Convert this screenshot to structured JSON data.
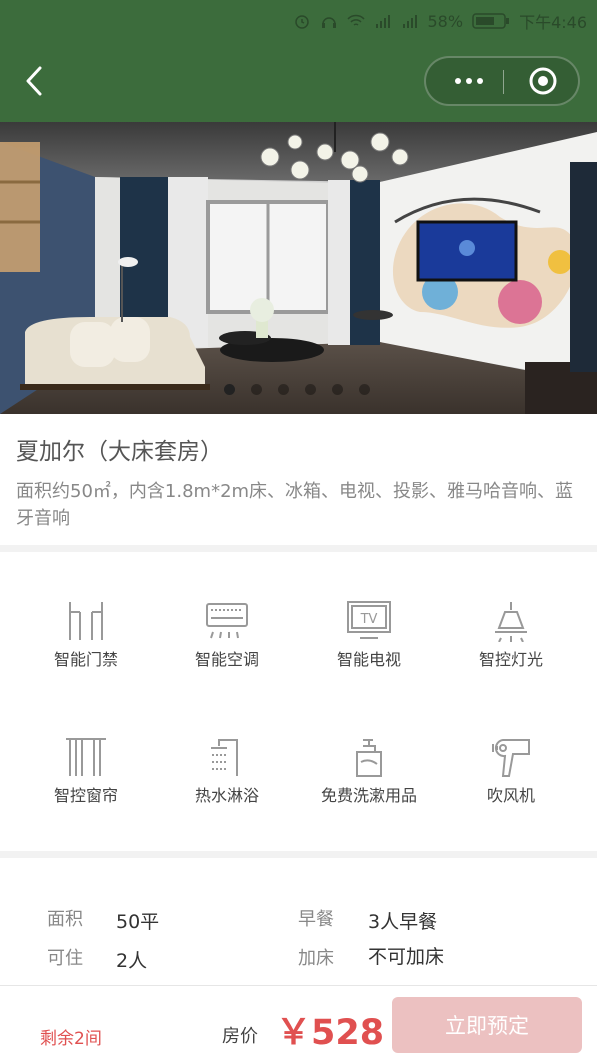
{
  "status_bar": {
    "battery": "58%",
    "time": "下午4:46"
  },
  "room": {
    "name": "夏加尔（大床套房）",
    "description": "面积约50㎡，内含1.8m*2m床、冰箱、电视、投影、雅马哈音响、蓝牙音响"
  },
  "carousel": {
    "count": 6,
    "active": 0
  },
  "amenities": [
    {
      "label": "智能门禁",
      "icon": "door-access-icon"
    },
    {
      "label": "智能空调",
      "icon": "air-conditioner-icon"
    },
    {
      "label": "智能电视",
      "icon": "tv-icon"
    },
    {
      "label": "智控灯光",
      "icon": "ceiling-light-icon"
    },
    {
      "label": "智控窗帘",
      "icon": "curtain-icon"
    },
    {
      "label": "热水淋浴",
      "icon": "shower-icon"
    },
    {
      "label": "免费洗漱用品",
      "icon": "toiletries-icon"
    },
    {
      "label": "吹风机",
      "icon": "hair-dryer-icon"
    }
  ],
  "details": {
    "area": {
      "label": "面积",
      "value": "50平"
    },
    "breakfast": {
      "label": "早餐",
      "value": "3人早餐"
    },
    "capacity": {
      "label": "可住",
      "value": "2人"
    },
    "extra_bed": {
      "label": "加床",
      "value": "不可加床"
    }
  },
  "footer": {
    "remaining": "剩余2间",
    "price_label": "房价",
    "price": "￥528",
    "book_label": "立即预定"
  },
  "colors": {
    "header": "#3c6c3c",
    "accent_red": "#e05050",
    "book_button": "#ecc1c1"
  }
}
